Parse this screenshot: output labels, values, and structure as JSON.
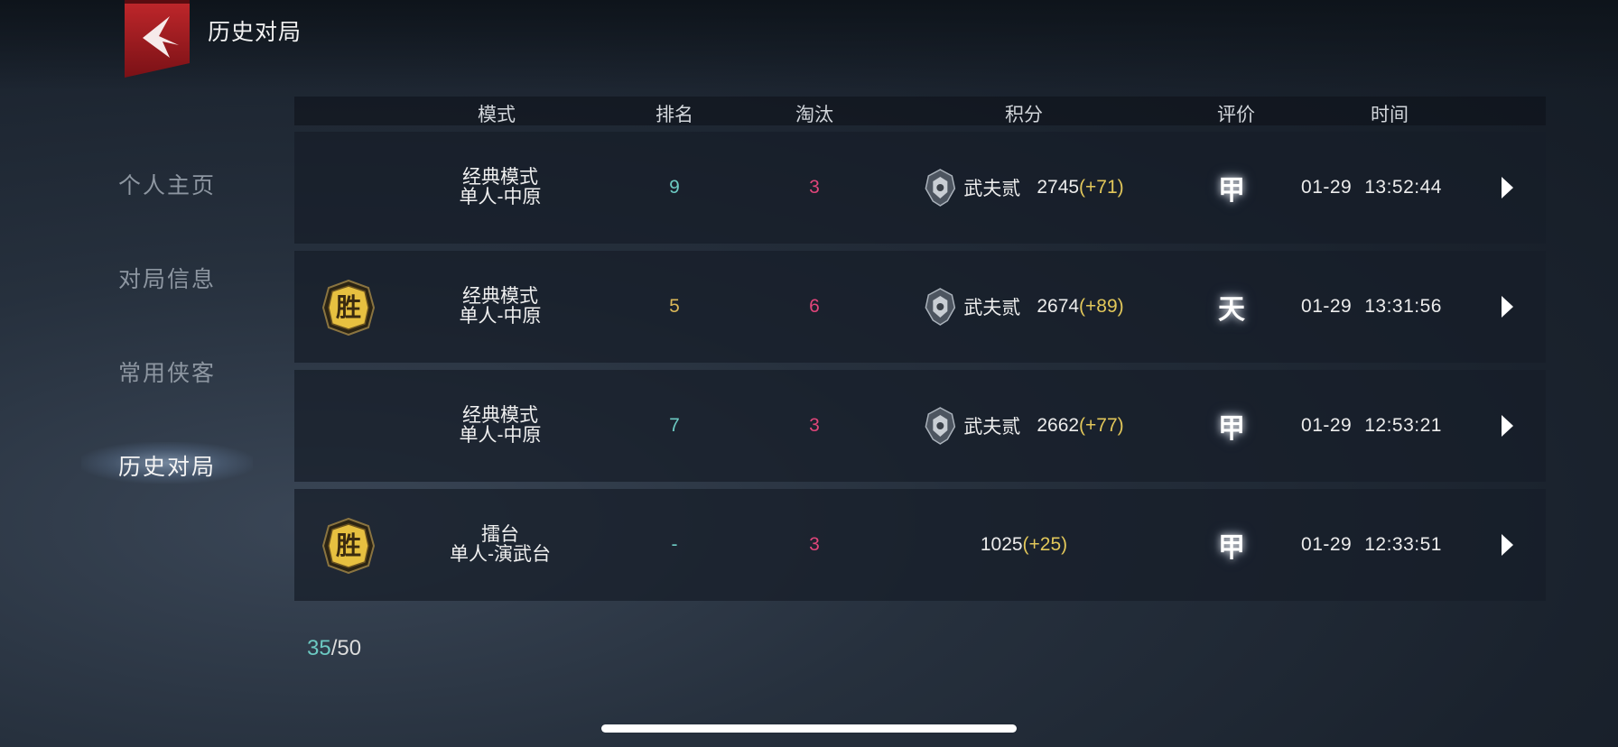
{
  "header": {
    "title": "历史对局",
    "back_icon": "back-chevron-icon"
  },
  "sidebar": {
    "items": [
      {
        "label": "个人主页",
        "active": false
      },
      {
        "label": "对局信息",
        "active": false
      },
      {
        "label": "常用侠客",
        "active": false
      },
      {
        "label": "历史对局",
        "active": true
      }
    ]
  },
  "table": {
    "columns": [
      "模式",
      "排名",
      "淘汰",
      "积分",
      "评价",
      "时间"
    ],
    "rows": [
      {
        "win": false,
        "mode_line1": "经典模式",
        "mode_line2": "单人-中原",
        "rank": "9",
        "eliminations": "3",
        "rank_title": "武夫贰",
        "score": "2745",
        "delta": "(+71)",
        "grade": "甲",
        "date": "01-29",
        "time": "13:52:44"
      },
      {
        "win": true,
        "win_label": "胜",
        "mode_line1": "经典模式",
        "mode_line2": "单人-中原",
        "rank": "5",
        "eliminations": "6",
        "rank_title": "武夫贰",
        "score": "2674",
        "delta": "(+89)",
        "grade": "天",
        "date": "01-29",
        "time": "13:31:56"
      },
      {
        "win": false,
        "mode_line1": "经典模式",
        "mode_line2": "单人-中原",
        "rank": "7",
        "eliminations": "3",
        "rank_title": "武夫贰",
        "score": "2662",
        "delta": "(+77)",
        "grade": "甲",
        "date": "01-29",
        "time": "12:53:21"
      },
      {
        "win": true,
        "win_label": "胜",
        "mode_line1": "擂台",
        "mode_line2": "单人-演武台",
        "rank": "-",
        "eliminations": "3",
        "rank_title": "",
        "score": "1025",
        "delta": "(+25)",
        "grade": "甲",
        "date": "01-29",
        "time": "12:33:51"
      }
    ]
  },
  "pager": {
    "current": "35",
    "separator": "/",
    "total": "50"
  },
  "colors": {
    "rank_cyan": "#6cc9c2",
    "rank_gold": "#d9b758",
    "eliminations": "#e0457a",
    "delta": "#e2c75a",
    "win_badge": "#e7c040"
  }
}
